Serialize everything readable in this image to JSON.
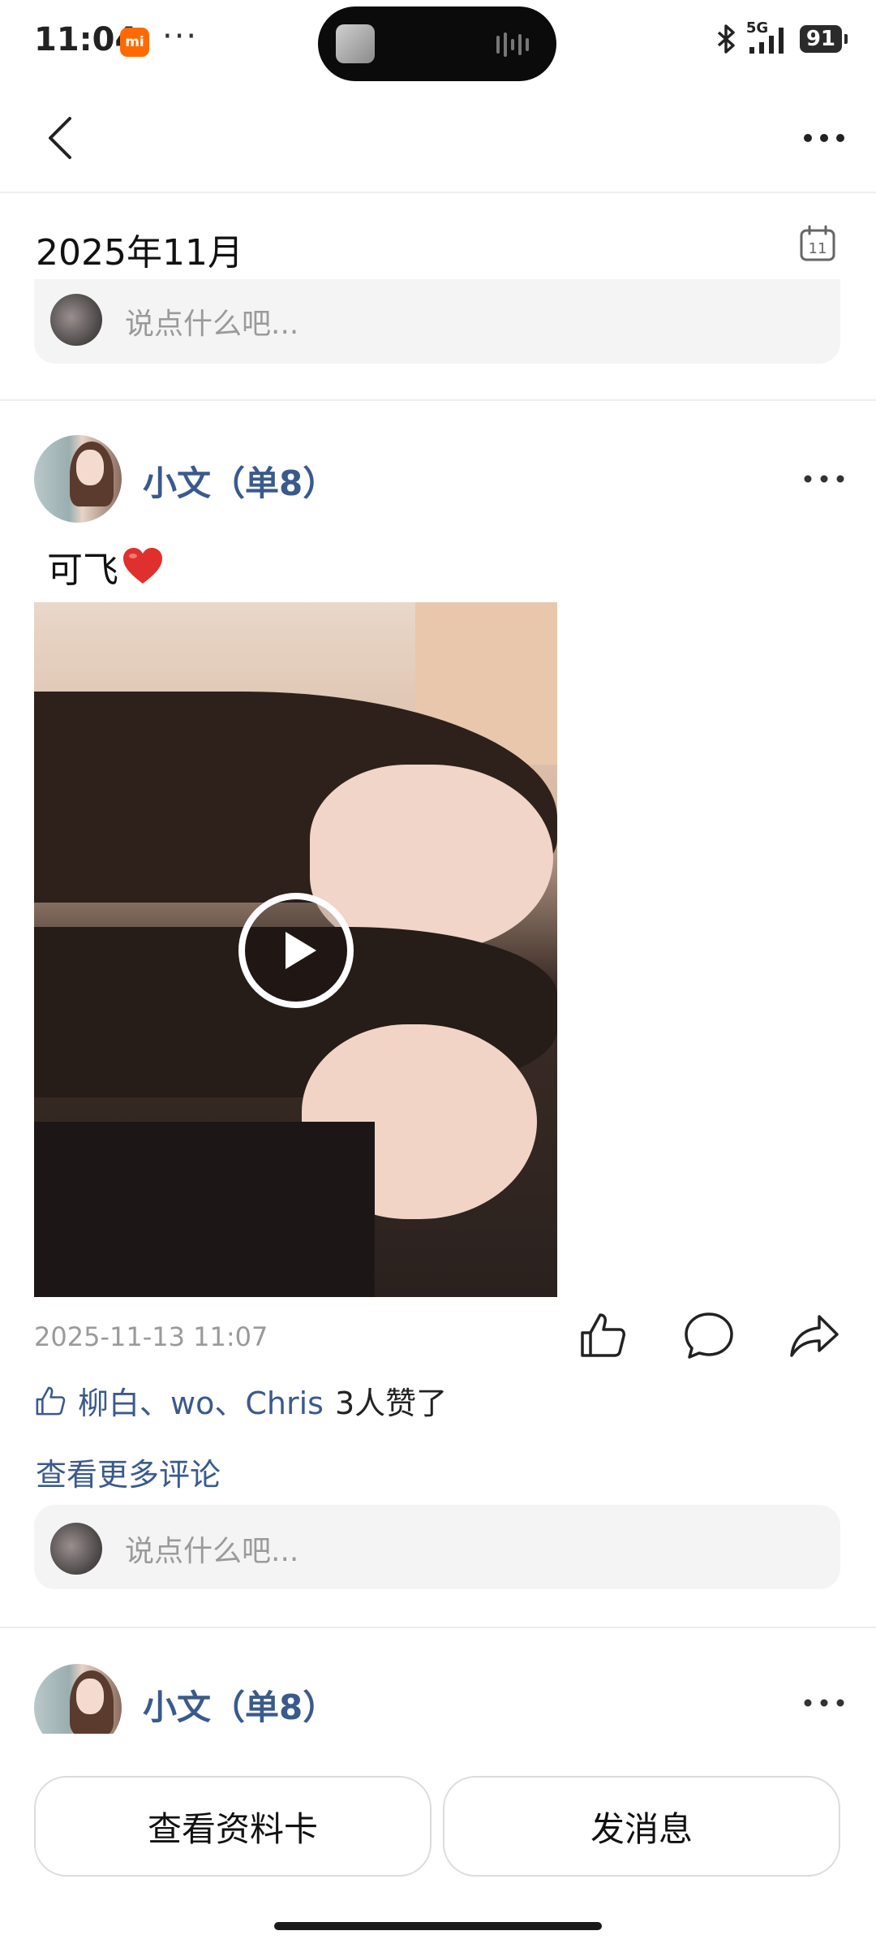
{
  "status_bar": {
    "time": "11:04",
    "badge": "mi",
    "dots": "···",
    "network": "5G",
    "battery": "91"
  },
  "header": {
    "month": "2025年11月"
  },
  "comment_input": {
    "placeholder": "说点什么吧..."
  },
  "posts": [
    {
      "author": "小文（单8）",
      "text": "可飞",
      "timestamp": "2025-11-13 11:07",
      "likes": {
        "names": "柳白、wo、Chris",
        "count_text": "3人赞了"
      },
      "more_comments": "查看更多评论",
      "comment_placeholder": "说点什么吧..."
    },
    {
      "author": "小文（单8）"
    }
  ],
  "bottom_bar": {
    "profile_button": "查看资料卡",
    "message_button": "发消息"
  },
  "colors": {
    "link": "#3a5a8c",
    "accent_badge": "#ff6a00",
    "muted": "#9a9a9a"
  }
}
